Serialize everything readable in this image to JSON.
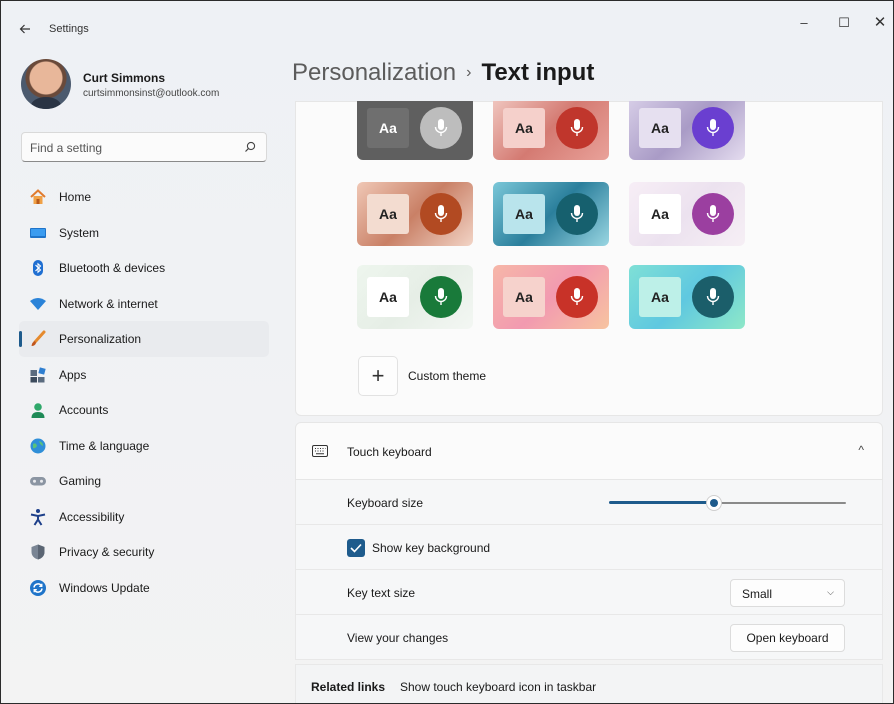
{
  "window": {
    "title": "Settings"
  },
  "window_controls": {
    "minimize": "–",
    "maximize": "☐",
    "close": "✕"
  },
  "account": {
    "name": "Curt Simmons",
    "email": "curtsimmonsinst@outlook.com"
  },
  "search": {
    "placeholder": "Find a setting"
  },
  "nav": {
    "items": [
      {
        "label": "Home",
        "icon": "home-icon"
      },
      {
        "label": "System",
        "icon": "system-icon"
      },
      {
        "label": "Bluetooth & devices",
        "icon": "bluetooth-icon"
      },
      {
        "label": "Network & internet",
        "icon": "network-icon"
      },
      {
        "label": "Personalization",
        "icon": "personalization-icon",
        "active": true
      },
      {
        "label": "Apps",
        "icon": "apps-icon"
      },
      {
        "label": "Accounts",
        "icon": "accounts-icon"
      },
      {
        "label": "Time & language",
        "icon": "time-language-icon"
      },
      {
        "label": "Gaming",
        "icon": "gaming-icon"
      },
      {
        "label": "Accessibility",
        "icon": "accessibility-icon"
      },
      {
        "label": "Privacy & security",
        "icon": "privacy-icon"
      },
      {
        "label": "Windows Update",
        "icon": "windows-update-icon"
      }
    ]
  },
  "breadcrumb": {
    "parent": "Personalization",
    "separator": "›",
    "current": "Text input"
  },
  "themes": {
    "tile_text": "Aa",
    "tiles": [
      {
        "bg": "#5f5f5f",
        "aa_bg": "#6f6f6f",
        "aa_color": "#ffffff",
        "mic": "#bdbdbd"
      },
      {
        "bg": "linear-gradient(135deg,#f1c9c2,#d47a72,#e9a29a)",
        "aa_bg": "#f5d0cb",
        "aa_color": "#222",
        "mic": "#c0362c"
      },
      {
        "bg": "linear-gradient(135deg,#d8cfe8,#a99bc6,#e4dcef)",
        "aa_bg": "#e6e0f0",
        "aa_color": "#222",
        "mic": "#6a3fd0"
      },
      {
        "bg": "linear-gradient(135deg,#f0c8b6,#c98066,#f2d4c6)",
        "aa_bg": "#f3dcd0",
        "aa_color": "#222",
        "mic": "#b24a22"
      },
      {
        "bg": "linear-gradient(135deg,#7ac7d8,#2b7f9c,#9ad6e2)",
        "aa_bg": "#b9e4ec",
        "aa_color": "#222",
        "mic": "#16606e"
      },
      {
        "bg": "linear-gradient(135deg,#f7eef6,#ece2ef,#f6eff5)",
        "aa_bg": "#ffffff",
        "aa_color": "#222",
        "mic": "#9b3fa0"
      },
      {
        "bg": "linear-gradient(135deg,#eef6ee,#e6eee6,#f3f7f3)",
        "aa_bg": "#ffffff",
        "aa_color": "#222",
        "mic": "#197a3a"
      },
      {
        "bg": "linear-gradient(135deg,#f6b7a8,#f29ab0,#f7c4a0)",
        "aa_bg": "#f6d2cc",
        "aa_color": "#222",
        "mic": "#c83228"
      },
      {
        "bg": "linear-gradient(135deg,#7fe0d6,#5fc8e0,#8ee8c8)",
        "aa_bg": "#bdf0e8",
        "aa_color": "#222",
        "mic": "#1b5e6a"
      }
    ],
    "custom_button": "+",
    "custom_label": "Custom theme"
  },
  "touch_keyboard": {
    "label": "Touch keyboard",
    "chevron": "^",
    "keyboard_size_label": "Keyboard size",
    "keyboard_size_value": 0.45,
    "show_key_background_label": "Show key background",
    "show_key_background_checked": true,
    "key_text_size_label": "Key text size",
    "key_text_size_value": "Small",
    "dropdown_chevron": "⌵",
    "view_changes_label": "View your changes",
    "open_keyboard_label": "Open keyboard"
  },
  "related": {
    "title": "Related links",
    "link": "Show touch keyboard icon in taskbar"
  },
  "colors": {
    "accent": "#1e5b8c"
  }
}
